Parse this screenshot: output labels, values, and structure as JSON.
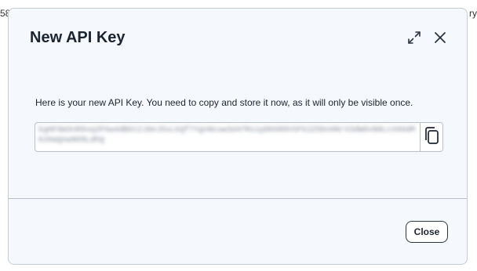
{
  "background": {
    "left_fragment": "58",
    "right_fragment": "ry"
  },
  "modal": {
    "title": "New API Key",
    "expand_icon": "expand-icon",
    "close_icon": "close-icon",
    "message": "Here is your new API Key. You need to copy and store it now, as it will only be visible once.",
    "api_key_masked": "kgHF8m3nR9vq2PXw4dB6tZJ8eJ5sLkQf7YgnNcuw3eH7Rs1pDHXR9VSFk2Z5bnHNrX3dW0vN8LcX6GdMK2HaQnw9D5LdhQ",
    "copy_icon": "copy-icon",
    "close_button_label": "Close"
  },
  "colors": {
    "modal_bg": "#f5f8fc",
    "border": "#b9c0c9",
    "text": "#1c2430"
  }
}
